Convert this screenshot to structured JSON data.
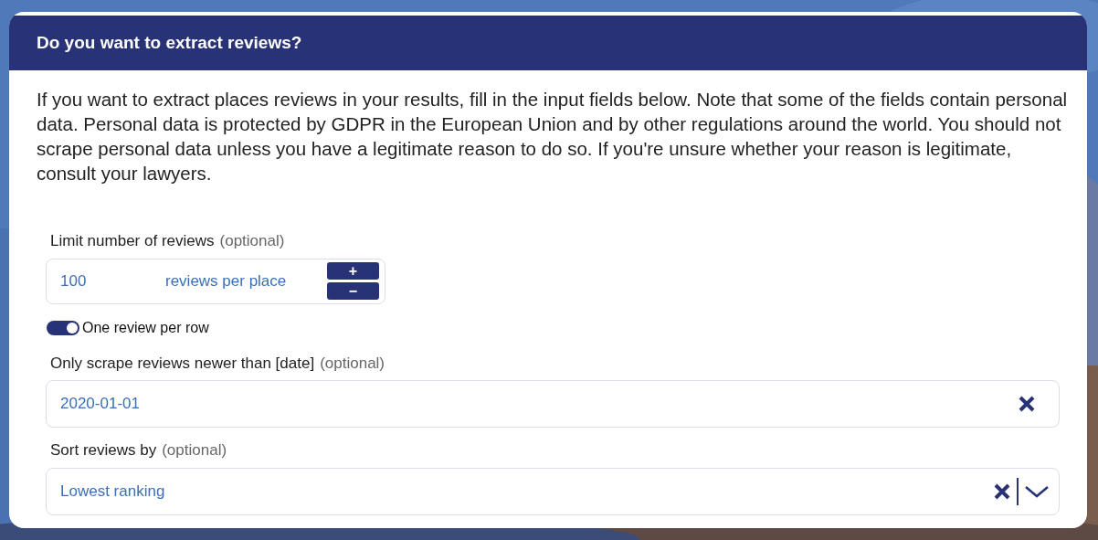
{
  "dialog": {
    "title": "Do you want to extract reviews?",
    "description": "If you want to extract places reviews in your results, fill in the input fields below. Note that some of the fields contain personal data. Personal data is protected by GDPR in the European Union and by other regulations around the world. You should not scrape personal data unless you have a legitimate reason to do so. If you're unsure whether your reason is legitimate, consult your lawyers.",
    "limit": {
      "label": "Limit number of reviews",
      "hint": "(optional)",
      "value": "100",
      "unit": "reviews per place",
      "increment": "+",
      "decrement": "−"
    },
    "one_per_row": {
      "label": "One review per row",
      "on": true
    },
    "date": {
      "label": "Only scrape reviews newer than [date]",
      "hint": "(optional)",
      "value": "2020-01-01"
    },
    "sort": {
      "label": "Sort reviews by",
      "hint": "(optional)",
      "value": "Lowest ranking"
    }
  }
}
